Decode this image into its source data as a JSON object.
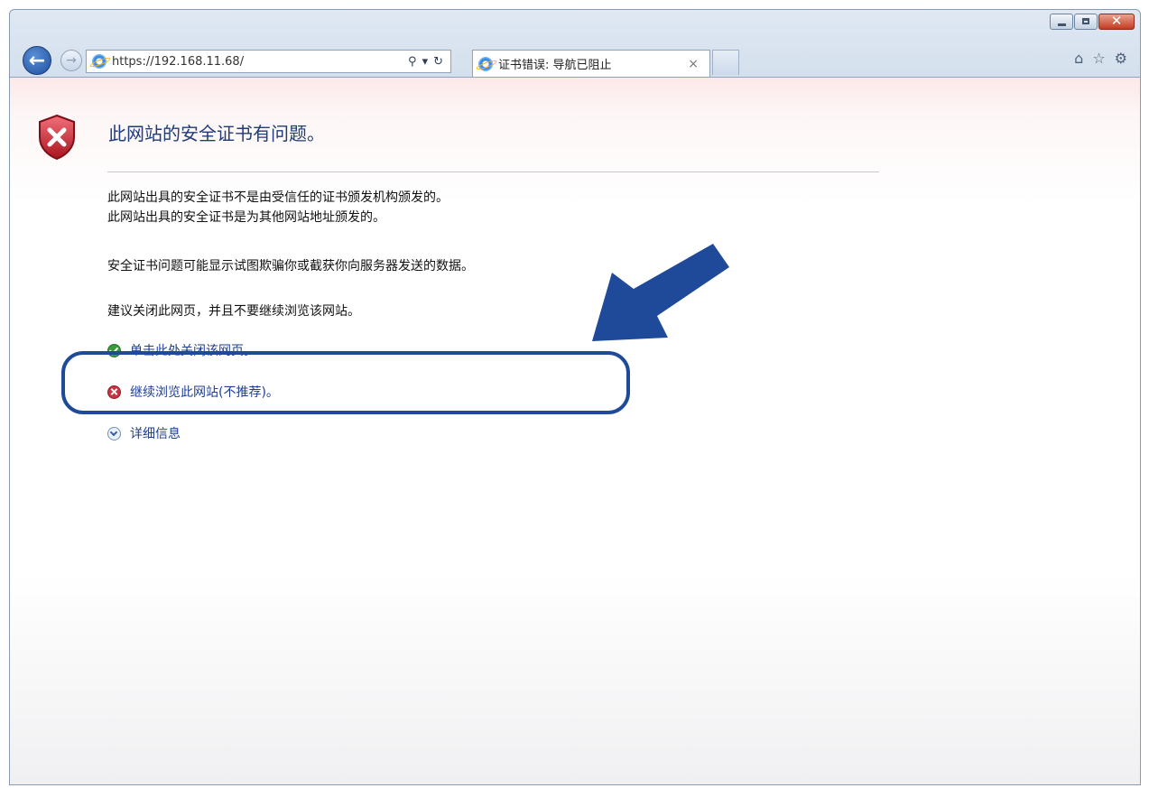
{
  "browser": {
    "url": "https://192.168.11.68/",
    "tab_title": "证书错误: 导航已阻止",
    "tab_close": "×",
    "address_controls": {
      "search": "⚲",
      "dropdown": "▾",
      "refresh": "↻"
    },
    "tools": {
      "home": "⌂",
      "favorites": "☆",
      "settings": "⚙"
    }
  },
  "page": {
    "heading": "此网站的安全证书有问题。",
    "reason_1": "此网站出具的安全证书不是由受信任的证书颁发机构颁发的。",
    "reason_2": "此网站出具的安全证书是为其他网站地址颁发的。",
    "warning": "安全证书问题可能显示试图欺骗你或截获你向服务器发送的数据。",
    "advice": "建议关闭此网页，并且不要继续浏览该网站。",
    "close_link": "单击此处关闭该网页。",
    "continue_link": "继续浏览此网站(不推荐)。",
    "more_info": "详细信息"
  },
  "colors": {
    "link": "#1f3f8f",
    "heading": "#1f3b7a",
    "annotation": "#1f4a9a"
  }
}
